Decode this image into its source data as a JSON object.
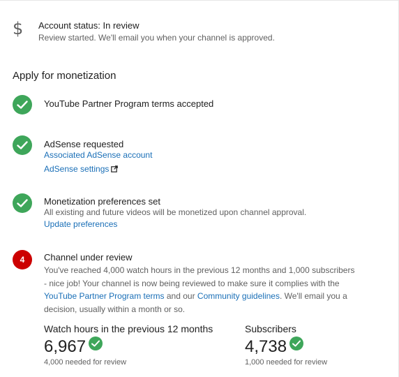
{
  "account_status": {
    "icon": "dollar-icon",
    "title": "Account status: In review",
    "subtitle": "Review started. We'll email you when your channel is approved."
  },
  "section_title": "Apply for monetization",
  "steps": [
    {
      "state": "done",
      "title": "YouTube Partner Program terms accepted"
    },
    {
      "state": "done",
      "title": "AdSense requested",
      "links": [
        "Associated AdSense account",
        "AdSense settings"
      ]
    },
    {
      "state": "done",
      "title": "Monetization preferences set",
      "description": "All existing and future videos will be monetized upon channel approval.",
      "link": "Update preferences"
    },
    {
      "state": "current",
      "number": "4",
      "title": "Channel under review",
      "paragraph": {
        "part1": "You've reached 4,000 watch hours in the previous 12 months and 1,000 subscribers - nice job! Your channel is now being reviewed to make sure it complies with the ",
        "link1": "YouTube Partner Program terms",
        "part2": " and our ",
        "link2": "Community guidelines",
        "part3": ". We'll email you a decision, usually within a month or so."
      }
    }
  ],
  "metrics": [
    {
      "label": "Watch hours in the previous 12 months",
      "value": "6,967",
      "requirement": "4,000 needed for review"
    },
    {
      "label": "Subscribers",
      "value": "4,738",
      "requirement": "1,000 needed for review"
    }
  ],
  "colors": {
    "check_green": "#3ea65a",
    "badge_red": "#cc0000",
    "link_blue": "#1a6fb7"
  }
}
